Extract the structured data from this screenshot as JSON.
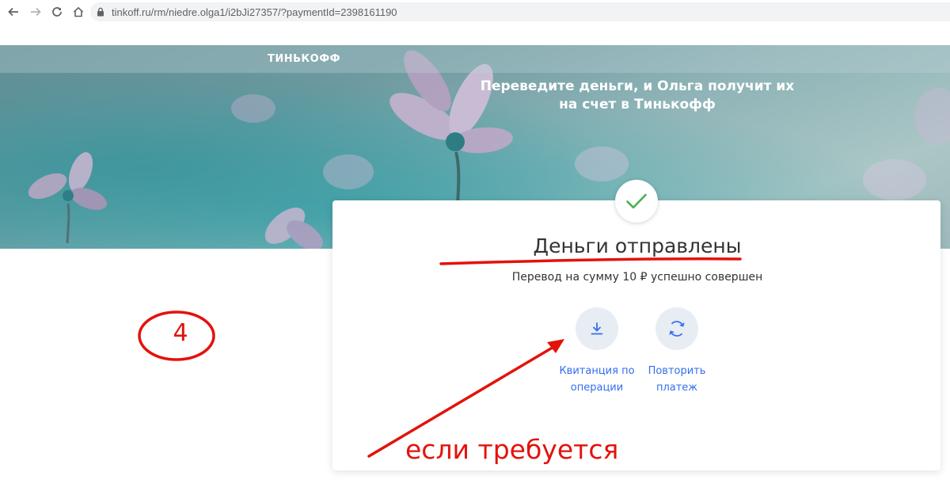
{
  "browser": {
    "url": "tinkoff.ru/rm/niedre.olga1/i2bJi27357/?paymentId=2398161190"
  },
  "hero": {
    "logo": "ТИНЬКОФФ",
    "headline_line1": "Переведите деньги, и Ольга получит их",
    "headline_line2": "на счет в Тинькофф"
  },
  "card": {
    "title": "Деньги отправлены",
    "subtitle": "Перевод на сумму 10 ₽ успешно совершен",
    "actions": [
      {
        "line1": "Квитанция по",
        "line2": "операции",
        "icon": "download-icon"
      },
      {
        "line1": "Повторить",
        "line2": "платеж",
        "icon": "repeat-icon"
      }
    ]
  },
  "annotations": {
    "step": "4",
    "note": "если требуется",
    "color": "#e3120b"
  },
  "colors": {
    "link": "#336fee",
    "check": "#4caf50",
    "title": "#333333"
  }
}
